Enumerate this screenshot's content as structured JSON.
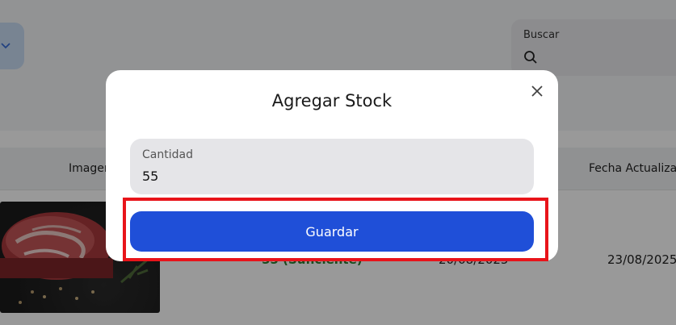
{
  "background": {
    "search": {
      "label": "Buscar"
    },
    "table": {
      "headers": {
        "image": "Imagen",
        "updated": "Fecha Actualizado"
      },
      "row": {
        "stock": "55 (Suficiente)",
        "created": "20/08/2025",
        "updated": "23/08/2025"
      }
    }
  },
  "modal": {
    "title": "Agregar Stock",
    "quantity_label": "Cantidad",
    "quantity_value": "55",
    "save_label": "Guardar"
  },
  "colors": {
    "primary_button": "#1f4fd8",
    "highlight_border": "#e8141a",
    "stock_ok": "#2e7d32"
  },
  "icons": {
    "close": "close-icon",
    "search": "search-icon",
    "dropdown": "chevron-down-icon"
  }
}
